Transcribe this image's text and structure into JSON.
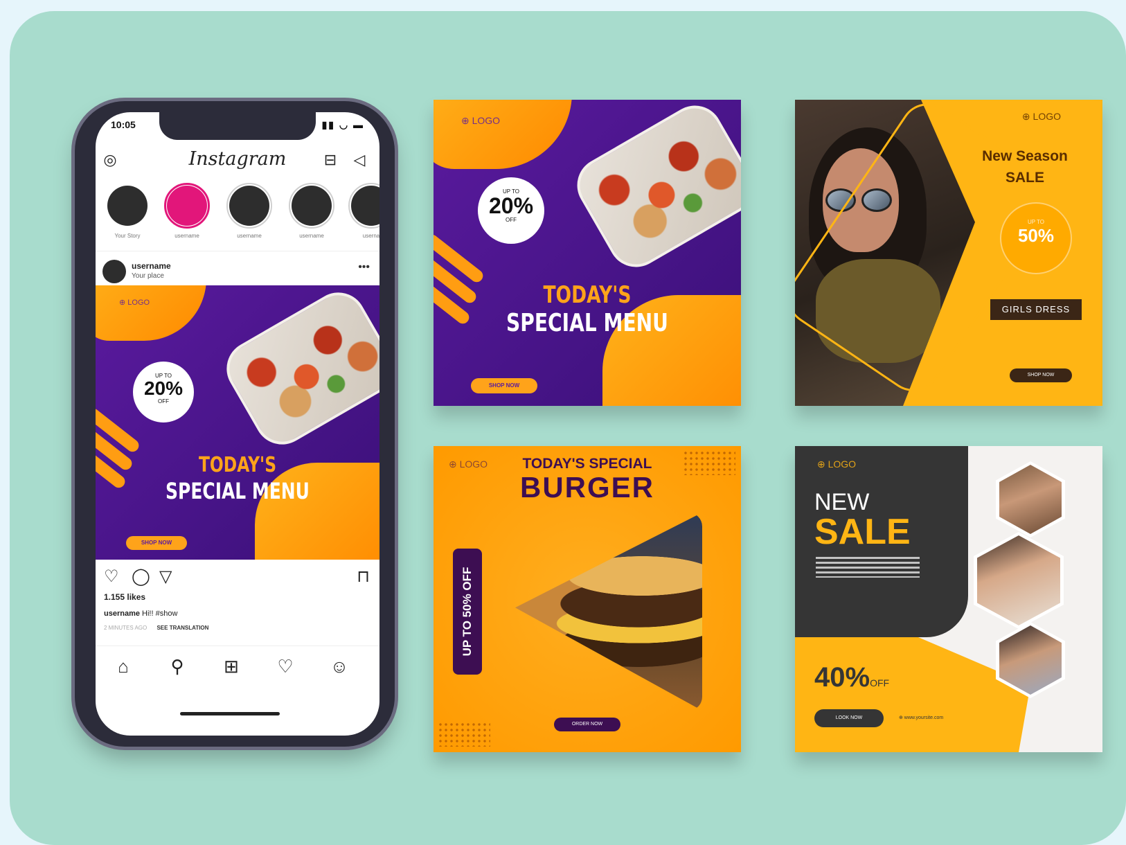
{
  "colors": {
    "background": "#a8dccd",
    "purple": "#5a1a9e",
    "orange": "#ffa31a",
    "yellow": "#ffb514",
    "dark": "#353535"
  },
  "phone": {
    "status_time": "10:05",
    "status_icons": "▮▮ ◡ ▬",
    "app_title": "Instagram",
    "header_icons": [
      "camera-icon",
      "igtv-icon",
      "send-icon"
    ],
    "stories": [
      {
        "label": "Your Story"
      },
      {
        "label": "username"
      },
      {
        "label": "username"
      },
      {
        "label": "username"
      },
      {
        "label": "userna"
      }
    ],
    "post": {
      "username": "username",
      "place": "Your place",
      "more": "•••",
      "likes": "1.155 likes",
      "caption_user": "username",
      "caption_text": "Hi!! #show",
      "timestamp": "2 MINUTES AGO",
      "see_translation": "SEE TRANSLATION"
    },
    "nav_icons": [
      "home-icon",
      "search-icon",
      "add-icon",
      "heart-icon",
      "profile-icon"
    ]
  },
  "food_card": {
    "logo": "⊕ LOGO",
    "up_to": "UP TO",
    "discount": "20%",
    "off": "OFF",
    "title_line1": "TODAY'S",
    "title_line2": "SPECIAL MENU",
    "button": "SHOP NOW"
  },
  "fashion_card": {
    "logo": "⊕ LOGO",
    "line1": "New Season",
    "line2": "SALE",
    "circle_sub": "UP TO",
    "discount": "50%",
    "tag": "GIRLS DRESS",
    "button": "SHOP NOW"
  },
  "burger_card": {
    "logo": "⊕ LOGO",
    "title_line1": "TODAY'S SPECIAL",
    "title_line2": "BURGER",
    "vertical_text": "UP TO 50% OFF",
    "button": "ORDER NOW"
  },
  "sale_card": {
    "logo": "⊕ LOGO",
    "line1": "NEW",
    "line2": "SALE",
    "discount": "40%",
    "off": "OFF",
    "button": "LOOK NOW",
    "website": "⊕ www.yoursite.com"
  }
}
